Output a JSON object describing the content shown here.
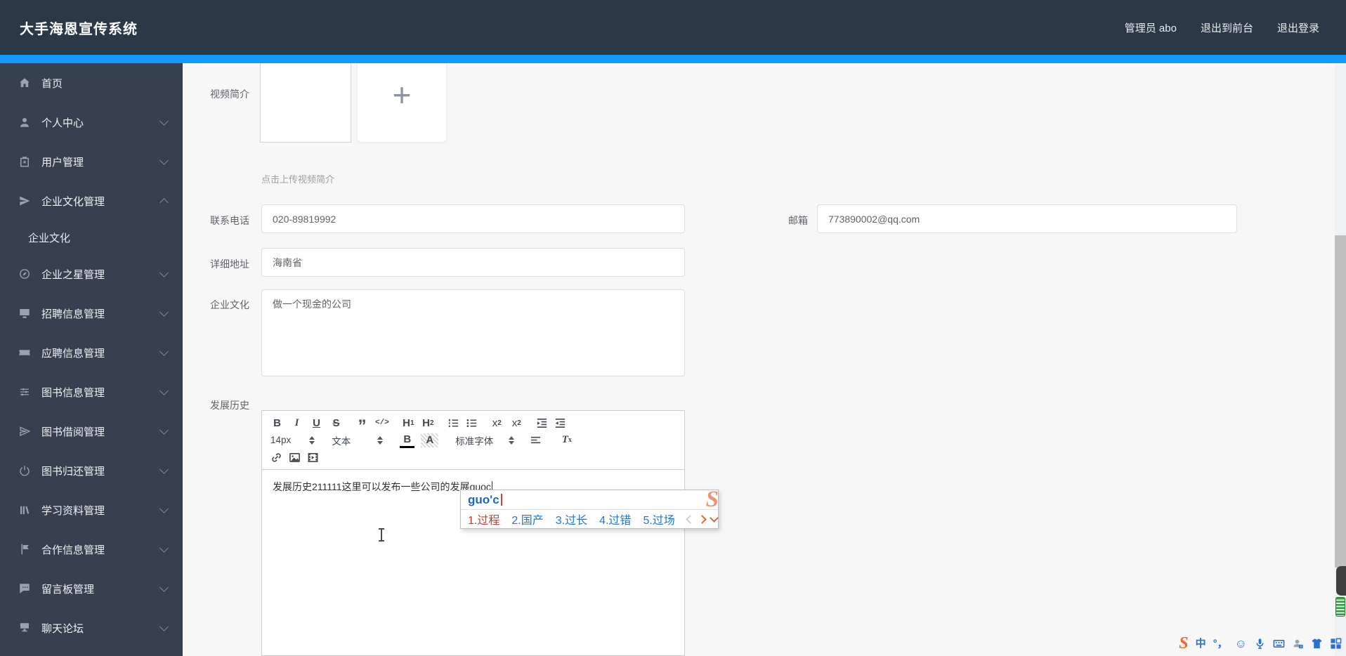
{
  "header": {
    "title": "大手海恩宣传系统",
    "admin": "管理员 abo",
    "exit_front": "退出到前台",
    "logout": "退出登录"
  },
  "sidebar": {
    "items": [
      {
        "label": "首页"
      },
      {
        "label": "个人中心"
      },
      {
        "label": "用户管理"
      },
      {
        "label": "企业文化管理"
      },
      {
        "label": "企业文化"
      },
      {
        "label": "企业之星管理"
      },
      {
        "label": "招聘信息管理"
      },
      {
        "label": "应聘信息管理"
      },
      {
        "label": "图书信息管理"
      },
      {
        "label": "图书借阅管理"
      },
      {
        "label": "图书归还管理"
      },
      {
        "label": "学习资料管理"
      },
      {
        "label": "合作信息管理"
      },
      {
        "label": "留言板管理"
      },
      {
        "label": "聊天论坛"
      }
    ]
  },
  "form": {
    "video": {
      "label": "视频简介",
      "plus": "+",
      "hint": "点击上传视频简介"
    },
    "phone": {
      "label": "联系电话",
      "value": "020-89819992"
    },
    "email": {
      "label": "邮箱",
      "value": "773890002@qq.com"
    },
    "address": {
      "label": "详细地址",
      "value": "海南省"
    },
    "culture": {
      "label": "企业文化",
      "value": "做一个现金的公司"
    },
    "history": {
      "label": "发展历史",
      "text": "发展历史211111这里可以发布一些公司的发展",
      "composing": "guoc"
    }
  },
  "editor": {
    "bold": "B",
    "italic": "I",
    "underline": "U",
    "strike": "S",
    "quote": "”",
    "code": "</>",
    "h": "H",
    "h1": "1",
    "h2": "2",
    "x": "x",
    "sub2": "2",
    "sup2": "2",
    "size": "14px",
    "type": "文本",
    "font": "标准字体",
    "clear_t": "T",
    "clear_x": "x"
  },
  "ime": {
    "composition": "guo'c",
    "logo": "S",
    "candidates": [
      "1.过程",
      "2.国产",
      "3.过长",
      "4.过错",
      "5.过场"
    ]
  },
  "ime_bar": {
    "logo": "S",
    "lang": "中",
    "punct": "°，",
    "smiley": "☺"
  },
  "colors": {
    "accent": "#1398fb",
    "topbar": "#2b3847",
    "sidebar": "#364050",
    "candidate_first": "#cd3c2e",
    "candidate": "#2176d2",
    "sogou_orange": "#f0886e"
  }
}
